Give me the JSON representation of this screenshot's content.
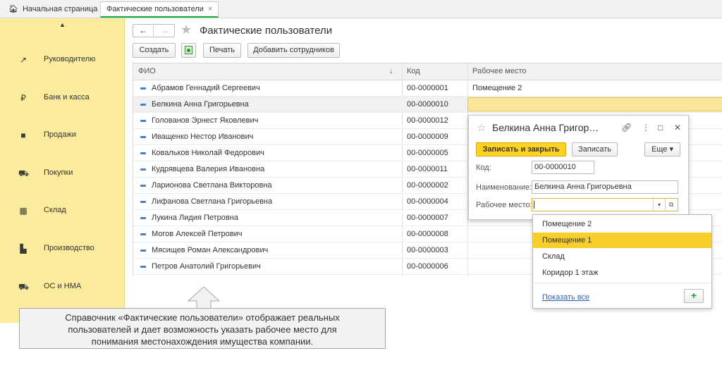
{
  "tabs": {
    "home_label": "Начальная страница",
    "active_label": "Фактические пользователи",
    "close_glyph": "×"
  },
  "sidebar": {
    "items": [
      {
        "label": "Руководителю",
        "icon": "trend-chart-icon"
      },
      {
        "label": "Банк и касса",
        "icon": "ruble-coin-icon"
      },
      {
        "label": "Продажи",
        "icon": "shopping-bag-icon"
      },
      {
        "label": "Покупки",
        "icon": "cart-icon"
      },
      {
        "label": "Склад",
        "icon": "warehouse-icon"
      },
      {
        "label": "Производство",
        "icon": "factory-icon"
      },
      {
        "label": "ОС и НМА",
        "icon": "truck-icon"
      }
    ]
  },
  "header": {
    "title": "Фактические пользователи"
  },
  "toolbar": {
    "create_label": "Создать",
    "print_label": "Печать",
    "add_employees_label": "Добавить сотрудников"
  },
  "table": {
    "col_fio": "ФИО",
    "col_sort": "↓",
    "col_code": "Код",
    "col_workplace": "Рабочее место",
    "rows": [
      {
        "name": "Абрамов Геннадий Сергеевич",
        "code": "00-0000001",
        "workplace": "Помещение 2"
      },
      {
        "name": "Белкина Анна Григорьевна",
        "code": "00-0000010",
        "workplace": ""
      },
      {
        "name": "Голованов Эрнест Яковлевич",
        "code": "00-0000012",
        "workplace": ""
      },
      {
        "name": "Иващенко Нестор Иванович",
        "code": "00-0000009",
        "workplace": ""
      },
      {
        "name": "Ковальков Николай Федорович",
        "code": "00-0000005",
        "workplace": ""
      },
      {
        "name": "Кудрявцева Валерия Ивановна",
        "code": "00-0000011",
        "workplace": ""
      },
      {
        "name": "Ларионова Светлана Викторовна",
        "code": "00-0000002",
        "workplace": ""
      },
      {
        "name": "Лифанова Светлана Григорьевна",
        "code": "00-0000004",
        "workplace": ""
      },
      {
        "name": "Лукина Лидия Петровна",
        "code": "00-0000007",
        "workplace": ""
      },
      {
        "name": "Могов Алексей Петрович",
        "code": "00-0000008",
        "workplace": ""
      },
      {
        "name": "Мясищев Роман Александрович",
        "code": "00-0000003",
        "workplace": ""
      },
      {
        "name": "Петров Анатолий Григорьевич",
        "code": "00-0000006",
        "workplace": ""
      }
    ]
  },
  "form": {
    "title": "Белкина Анна Григор…",
    "save_close_label": "Записать и закрыть",
    "save_label": "Записать",
    "more_label": "Еще ▾",
    "code_label": "Код:",
    "code_value": "00-0000010",
    "name_label": "Наименование:",
    "name_value": "Белкина Анна Григорьевна",
    "workplace_label": "Рабочее место:",
    "workplace_value": ""
  },
  "dropdown": {
    "options": [
      "Помещение 2",
      "Помещение 1",
      "Склад",
      "Коридор 1 этаж"
    ],
    "highlighted_index": 1,
    "show_all_label": "Показать все",
    "add_glyph": "+"
  },
  "callout": {
    "lines": [
      "Справочник «Фактические пользователи» отображает реальных",
      "пользователей и дает возможность указать рабочее место для",
      "понимания местонахождения имущества компании."
    ]
  },
  "colors": {
    "sidebar_bg": "#fbeb9c",
    "primary_button": "#ffd21f",
    "highlight_option": "#f8ce2b",
    "tab_accent": "#1cae3d",
    "row_marker": "#4a7ec0"
  }
}
